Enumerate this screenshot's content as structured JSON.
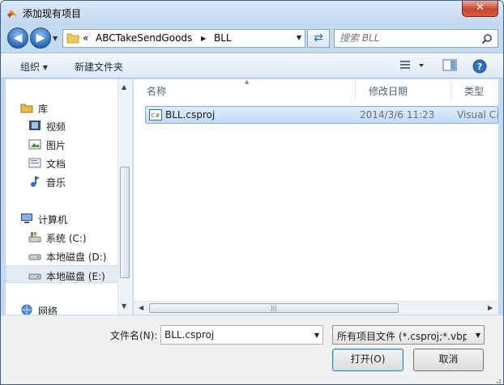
{
  "window": {
    "title": "添加现有项目",
    "close_label": "✕"
  },
  "nav": {
    "back": "◀",
    "forward": "▶"
  },
  "address": {
    "prefix": "«",
    "crumbs": [
      "ABCTakeSendGoods",
      "BLL"
    ]
  },
  "search": {
    "placeholder": "搜索 BLL"
  },
  "toolbar": {
    "organize": "组织 ▾",
    "new_folder": "新建文件夹"
  },
  "sidebar": {
    "items": [
      {
        "label": "库",
        "icon": "library-icon"
      },
      {
        "label": "视频",
        "icon": "video-icon"
      },
      {
        "label": "图片",
        "icon": "picture-icon"
      },
      {
        "label": "文档",
        "icon": "document-icon"
      },
      {
        "label": "音乐",
        "icon": "music-icon"
      },
      {
        "label": "计算机",
        "icon": "computer-icon"
      },
      {
        "label": "系统 (C:)",
        "icon": "system-drive-icon"
      },
      {
        "label": "本地磁盘 (D:)",
        "icon": "drive-icon"
      },
      {
        "label": "本地磁盘 (E:)",
        "icon": "drive-icon"
      },
      {
        "label": "网络",
        "icon": "network-icon"
      }
    ]
  },
  "columns": {
    "name": "名称",
    "modified": "修改日期",
    "type": "类型"
  },
  "files": [
    {
      "name": "BLL.csproj",
      "modified": "2014/3/6 11:23",
      "type": "Visual C#"
    }
  ],
  "bottom": {
    "filename_label": "文件名(N):",
    "filename_value": "BLL.csproj",
    "filetype_value": "所有项目文件 (*.csproj;*.vbproj",
    "open_button": "打开(O)",
    "cancel_button": "取消"
  },
  "colors": {
    "title_bar": "#c2d8f0",
    "selection": "#c3dcf8",
    "toolbar": "#dde9f6"
  }
}
